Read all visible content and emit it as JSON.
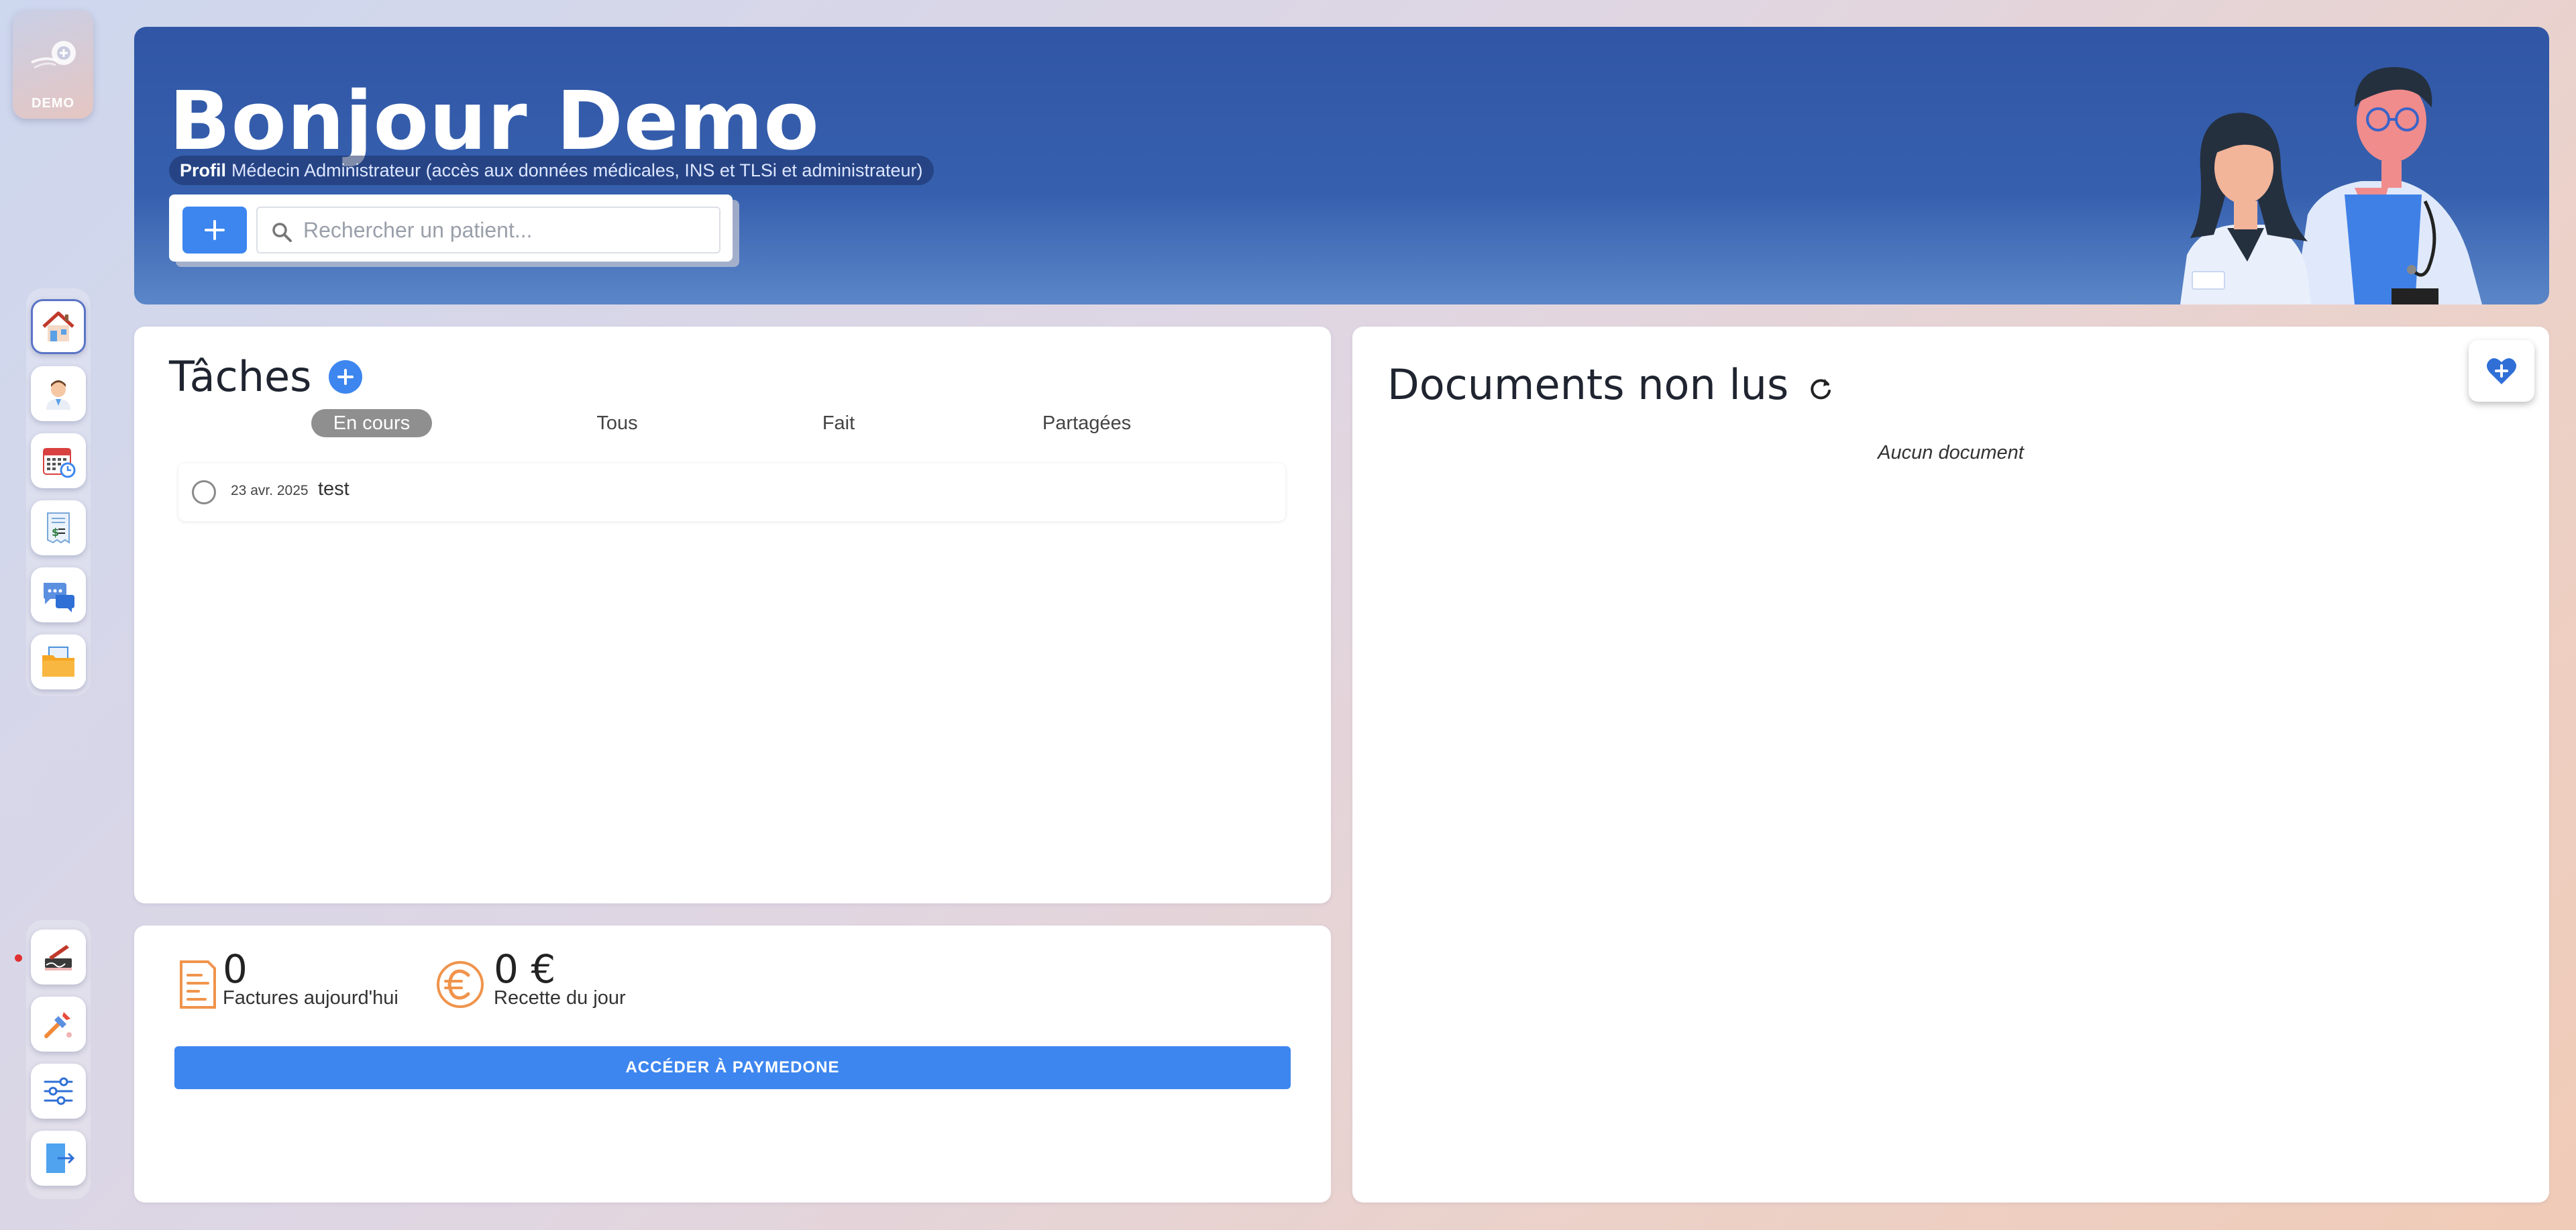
{
  "app": {
    "logo_text": "DEMO"
  },
  "header": {
    "greeting": "Bonjour Demo",
    "profile_label": "Profil",
    "profile_text": "Médecin Administrateur (accès aux données médicales, INS et TLSi et administrateur)",
    "search_placeholder": "Rechercher un patient..."
  },
  "sidebar": {
    "top_items": [
      {
        "name": "home",
        "icon": "home-icon",
        "active": true
      },
      {
        "name": "patients",
        "icon": "doctor-avatar-icon",
        "active": false
      },
      {
        "name": "agenda",
        "icon": "calendar-icon",
        "active": false
      },
      {
        "name": "billing",
        "icon": "invoice-icon",
        "active": false
      },
      {
        "name": "messages",
        "icon": "chat-icon",
        "active": false
      },
      {
        "name": "documents",
        "icon": "folder-icon",
        "active": false
      }
    ],
    "bottom_items": [
      {
        "name": "signature",
        "icon": "signature-icon",
        "has_notification": true
      },
      {
        "name": "tools",
        "icon": "tools-icon",
        "has_notification": false
      },
      {
        "name": "settings",
        "icon": "sliders-icon",
        "has_notification": false
      },
      {
        "name": "logout",
        "icon": "logout-icon",
        "has_notification": false
      }
    ]
  },
  "tasks": {
    "title": "Tâches",
    "filters": [
      "En cours",
      "Tous",
      "Fait",
      "Partagées"
    ],
    "active_filter": "En cours",
    "items": [
      {
        "date": "23 avr. 2025",
        "label": "test",
        "done": false
      }
    ]
  },
  "documents": {
    "title": "Documents non lus",
    "empty_text": "Aucun document"
  },
  "billing": {
    "invoices_value": "0",
    "invoices_label": "Factures aujourd'hui",
    "revenue_value": "0 €",
    "revenue_label": "Recette du jour",
    "cta_label": "ACCÉDER À PAYMEDONE"
  },
  "colors": {
    "header_blue": "#3056a5",
    "accent_blue": "#3d86ef",
    "stat_orange": "#f0944c",
    "active_filter_gray": "#8f8f8f"
  }
}
